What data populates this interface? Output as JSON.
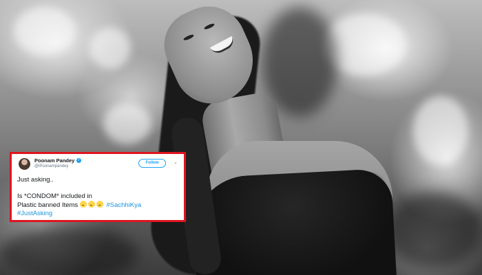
{
  "tweet": {
    "author_name": "Poonam Pandey",
    "handle": "@iPoonampandey",
    "follow_label": "Follow",
    "chevron": "⌄",
    "line1": "Just asking..",
    "line2": "Is *CONDOM* included in",
    "line3_text": "Plastic banned Items",
    "emojis": [
      "thinking-face-emoji",
      "thinking-face-emoji",
      "thinking-face-emoji"
    ],
    "hashtag1": "#SachhiKya",
    "hashtag2": "#JustAsking",
    "highlight_color": "#e0141e",
    "link_color": "#1b95e0",
    "verified_color": "#1da1f2"
  }
}
